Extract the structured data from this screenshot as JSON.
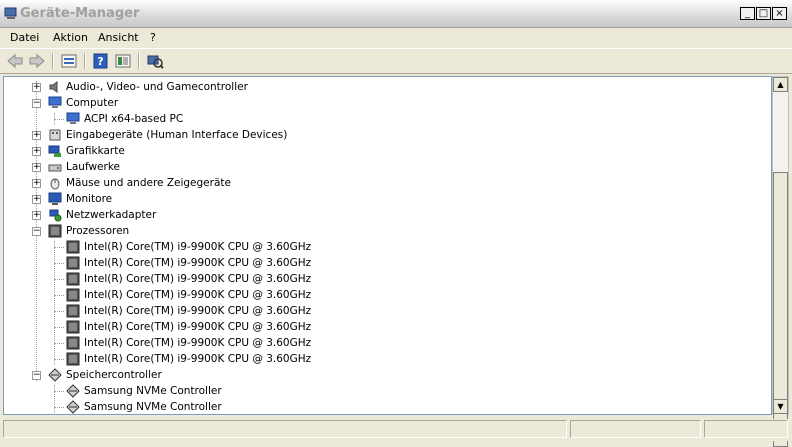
{
  "window": {
    "title": "Geräte-Manager",
    "controls": {
      "minimize": "_",
      "maximize": "□",
      "close": "×"
    }
  },
  "menu": {
    "items": [
      "Datei",
      "Aktion",
      "Ansicht",
      "?"
    ]
  },
  "toolbar": {
    "icons": [
      "back-icon",
      "forward-icon",
      "properties-icon",
      "help-icon",
      "view-icon",
      "scan-hardware-icon"
    ]
  },
  "tree": {
    "rows": [
      {
        "label": "Audio-, Video- und Gamecontroller",
        "expander": "+",
        "icon": "speaker-icon"
      },
      {
        "label": "Computer",
        "expander": "−",
        "icon": "computer-icon"
      },
      {
        "label": "ACPI x64-based PC",
        "icon": "computer-icon"
      },
      {
        "label": "Eingabegeräte (Human Interface Devices)",
        "expander": "+",
        "icon": "hid-icon"
      },
      {
        "label": "Grafikkarte",
        "expander": "+",
        "icon": "display-adapter-icon"
      },
      {
        "label": "Laufwerke",
        "expander": "+",
        "icon": "disk-drive-icon"
      },
      {
        "label": "Mäuse und andere Zeigegeräte",
        "expander": "+",
        "icon": "mouse-icon"
      },
      {
        "label": "Monitore",
        "expander": "+",
        "icon": "monitor-icon"
      },
      {
        "label": "Netzwerkadapter",
        "expander": "+",
        "icon": "network-adapter-icon"
      },
      {
        "label": "Prozessoren",
        "expander": "−",
        "icon": "processor-icon"
      },
      {
        "label": "Intel(R) Core(TM) i9-9900K CPU @ 3.60GHz",
        "icon": "processor-icon"
      },
      {
        "label": "Intel(R) Core(TM) i9-9900K CPU @ 3.60GHz",
        "icon": "processor-icon"
      },
      {
        "label": "Intel(R) Core(TM) i9-9900K CPU @ 3.60GHz",
        "icon": "processor-icon"
      },
      {
        "label": "Intel(R) Core(TM) i9-9900K CPU @ 3.60GHz",
        "icon": "processor-icon"
      },
      {
        "label": "Intel(R) Core(TM) i9-9900K CPU @ 3.60GHz",
        "icon": "processor-icon"
      },
      {
        "label": "Intel(R) Core(TM) i9-9900K CPU @ 3.60GHz",
        "icon": "processor-icon"
      },
      {
        "label": "Intel(R) Core(TM) i9-9900K CPU @ 3.60GHz",
        "icon": "processor-icon"
      },
      {
        "label": "Intel(R) Core(TM) i9-9900K CPU @ 3.60GHz",
        "icon": "processor-icon"
      },
      {
        "label": "Speichercontroller",
        "expander": "−",
        "icon": "storage-controller-icon"
      },
      {
        "label": "Samsung NVMe Controller",
        "icon": "storage-controller-icon"
      },
      {
        "label": "Samsung NVMe Controller",
        "icon": "storage-controller-icon"
      }
    ]
  },
  "scrollbar": {
    "up": "▲",
    "down": "▼"
  },
  "colors": {
    "accent": "#0a246a",
    "window_bg": "#ece9d8",
    "tree_bg": "#ffffff"
  }
}
